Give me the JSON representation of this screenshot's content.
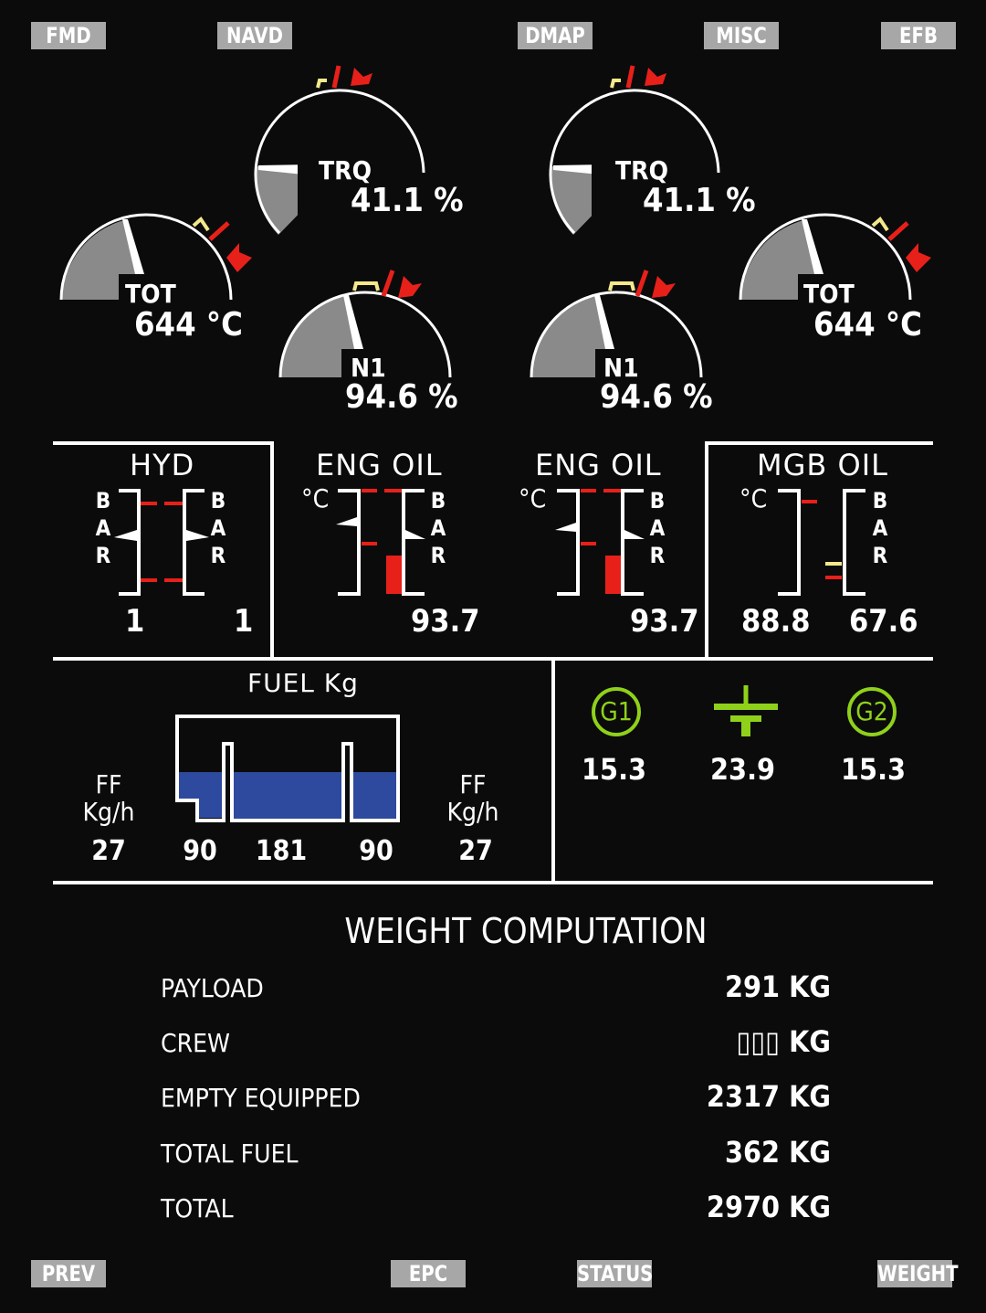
{
  "top_nav": {
    "fmd": "FMD",
    "navd": "NAVD",
    "dmap": "DMAP",
    "misc": "MISC",
    "efb": "EFB"
  },
  "bottom_nav": {
    "prev": "PREV",
    "epc": "EPC",
    "status": "STATUS",
    "weight": "WEIGHT"
  },
  "gauges": {
    "left": {
      "trq": {
        "label": "TRQ",
        "value": "41.1 %"
      },
      "tot": {
        "label": "TOT",
        "value": "644 °C"
      },
      "n1": {
        "label": "N1",
        "value": "94.6 %"
      }
    },
    "right": {
      "trq": {
        "label": "TRQ",
        "value": "41.1 %"
      },
      "tot": {
        "label": "TOT",
        "value": "644 °C"
      },
      "n1": {
        "label": "N1",
        "value": "94.6 %"
      }
    }
  },
  "hyd": {
    "title": "HYD",
    "bar_letters": [
      "B",
      "A",
      "R"
    ],
    "value_left": "1",
    "value_right": "1"
  },
  "eng_oil_left": {
    "title": "ENG OIL",
    "temp_unit": "°C",
    "bar_letters": [
      "B",
      "A",
      "R"
    ],
    "value": "93.7"
  },
  "eng_oil_right": {
    "title": "ENG OIL",
    "temp_unit": "°C",
    "bar_letters": [
      "B",
      "A",
      "R"
    ],
    "value": "93.7"
  },
  "mgb_oil": {
    "title": "MGB OIL",
    "temp_unit": "°C",
    "bar_letters": [
      "B",
      "A",
      "R"
    ],
    "temp_value": "88.8",
    "pressure_value": "67.6"
  },
  "fuel": {
    "title": "FUEL Kg",
    "ff_label": "FF",
    "ff_unit": "Kg/h",
    "ff_left": "27",
    "ff_right": "27",
    "tank_left": "90",
    "tank_center": "181",
    "tank_right": "90",
    "fill_color": "#2e4a9e"
  },
  "electrical": {
    "g1": {
      "label": "G1",
      "value": "15.3"
    },
    "battery": {
      "value": "23.9"
    },
    "g2": {
      "label": "G2",
      "value": "15.3"
    },
    "color": "#8fd11a"
  },
  "weight": {
    "title": "WEIGHT COMPUTATION",
    "rows": [
      {
        "label": "PAYLOAD",
        "value": "291 KG"
      },
      {
        "label": "CREW",
        "value": "▯▯▯ KG"
      },
      {
        "label": "EMPTY EQUIPPED",
        "value": "2317 KG"
      },
      {
        "label": "TOTAL FUEL",
        "value": "362 KG"
      },
      {
        "label": "TOTAL",
        "value": "2970 KG"
      }
    ]
  },
  "colors": {
    "background": "#0b0b0b",
    "button": "#a7a7a7",
    "red_limit": "#e8201a",
    "yellow_caution": "#f3e98a",
    "gauge_fill": "#8a8a8a"
  }
}
